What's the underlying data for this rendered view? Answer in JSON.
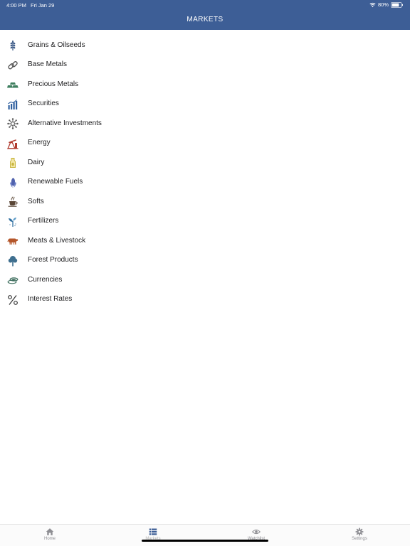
{
  "status_bar": {
    "time": "4:00 PM",
    "date": "Fri Jan 29",
    "battery": "80%"
  },
  "header": {
    "title": "MARKETS"
  },
  "markets": [
    {
      "label": "Grains & Oilseeds",
      "icon": "wheat-icon",
      "color": "#2f4f7f"
    },
    {
      "label": "Base Metals",
      "icon": "chain-link-icon",
      "color": "#555555"
    },
    {
      "label": "Precious Metals",
      "icon": "gold-bars-icon",
      "color": "#3f7f5f"
    },
    {
      "label": "Securities",
      "icon": "bar-chart-icon",
      "color": "#2f5f9f"
    },
    {
      "label": "Alternative Investments",
      "icon": "network-icon",
      "color": "#555555"
    },
    {
      "label": "Energy",
      "icon": "oil-pump-icon",
      "color": "#b03a2e"
    },
    {
      "label": "Dairy",
      "icon": "milk-bottle-icon",
      "color": "#c9b640"
    },
    {
      "label": "Renewable Fuels",
      "icon": "corn-icon",
      "color": "#3b4fa0"
    },
    {
      "label": "Softs",
      "icon": "coffee-cup-icon",
      "color": "#5a4636"
    },
    {
      "label": "Fertilizers",
      "icon": "sprout-icon",
      "color": "#2f6fa0"
    },
    {
      "label": "Meats & Livestock",
      "icon": "cow-icon",
      "color": "#b4562a"
    },
    {
      "label": "Forest Products",
      "icon": "tree-icon",
      "color": "#3f6f8f"
    },
    {
      "label": "Currencies",
      "icon": "coins-icon",
      "color": "#3f6f5f"
    },
    {
      "label": "Interest Rates",
      "icon": "percent-icon",
      "color": "#333333"
    }
  ],
  "tabs": [
    {
      "label": "Home",
      "icon": "home-icon"
    },
    {
      "label": "Markets",
      "icon": "list-icon"
    },
    {
      "label": "Watchlist",
      "icon": "eye-icon"
    },
    {
      "label": "Settings",
      "icon": "gear-icon"
    }
  ],
  "colors": {
    "header": "#3d5e96",
    "tab_active": "#3d5e96",
    "tab_inactive": "#8e8e93"
  }
}
